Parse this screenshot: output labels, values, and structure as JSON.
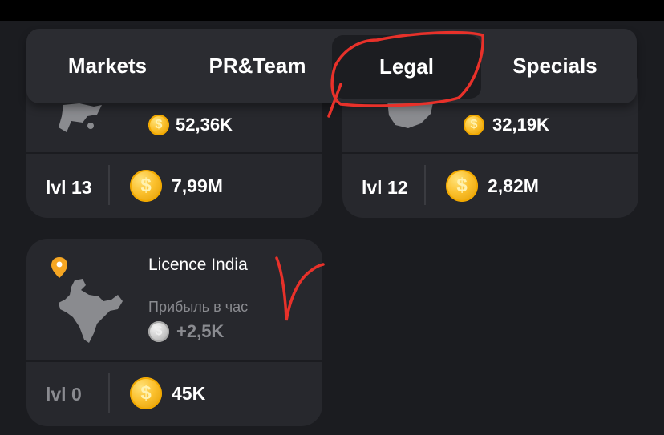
{
  "tabs": [
    {
      "label": "Markets"
    },
    {
      "label": "PR&Team"
    },
    {
      "label": "Legal"
    },
    {
      "label": "Specials"
    }
  ],
  "cards": [
    {
      "profit_value": "52,36K",
      "level": "lvl 13",
      "cost": "7,99M"
    },
    {
      "profit_value": "32,19K",
      "level": "lvl 12",
      "cost": "2,82M"
    },
    {
      "title": "Licence India",
      "profit_label": "Прибыль в час",
      "profit_value": "+2,5K",
      "level": "lvl 0",
      "cost": "45K"
    }
  ],
  "colors": {
    "background": "#1b1c20",
    "card": "#27282d",
    "coin_gold": "#fbc02d",
    "annotation_red": "#e8312a",
    "pin_orange": "#f5a623"
  },
  "icons": {
    "coin": "dollar-coin-icon",
    "pin": "location-pin-icon",
    "map": "india-map-icon"
  }
}
